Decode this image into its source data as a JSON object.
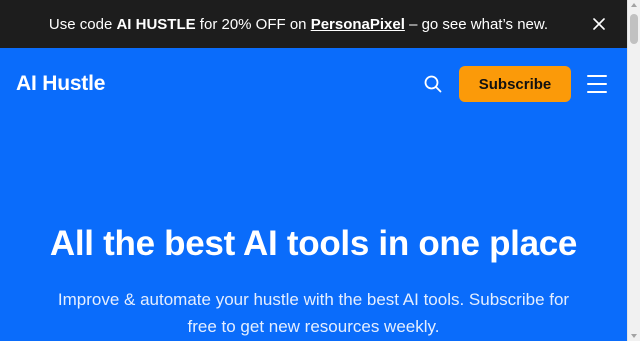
{
  "promo_bar": {
    "prefix": "Use code ",
    "code": "AI HUSTLE",
    "middle": " for 20% OFF on ",
    "link_text": "PersonaPixel",
    "suffix": " – go see what’s new."
  },
  "header": {
    "logo": "AI Hustle",
    "subscribe_label": "Subscribe"
  },
  "hero": {
    "headline": "All the best AI tools in one place",
    "subtext_line1": "Improve & automate your hustle with the best AI tools. Subscribe for",
    "subtext_line2": "free to get new resources weekly."
  },
  "colors": {
    "promo_bg": "#1d1d1d",
    "hero_bg": "#0a6cfb",
    "accent": "#fb9a09"
  },
  "icons": [
    "close-icon",
    "search-icon",
    "menu-icon"
  ]
}
